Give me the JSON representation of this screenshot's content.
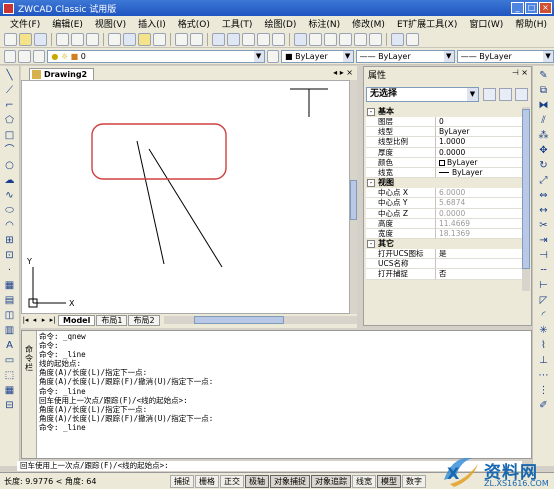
{
  "window": {
    "title": "ZWCAD Classic 试用版"
  },
  "menu": [
    "文件(F)",
    "编辑(E)",
    "视图(V)",
    "插入(I)",
    "格式(O)",
    "工具(T)",
    "绘图(D)",
    "标注(N)",
    "修改(M)",
    "ET扩展工具(X)",
    "窗口(W)",
    "帮助(H)"
  ],
  "toolbar": {
    "layer_value": "0",
    "color_value": "ByLayer",
    "linetype_value": "ByLayer",
    "lineweight_value": "ByLayer"
  },
  "document": {
    "tab_label": "Drawing2",
    "layout_tabs": [
      "Model",
      "布局1",
      "布局2"
    ],
    "ucs_x_label": "X",
    "ucs_y_label": "Y"
  },
  "properties": {
    "title": "属性",
    "selection": "无选择",
    "categories": [
      {
        "name": "基本",
        "rows": [
          {
            "key": "图层",
            "value": "0"
          },
          {
            "key": "线型",
            "value": "ByLayer"
          },
          {
            "key": "线型比例",
            "value": "1.0000"
          },
          {
            "key": "厚度",
            "value": "0.0000"
          },
          {
            "key": "颜色",
            "value": "ByLayer"
          },
          {
            "key": "线宽",
            "value": "ByLayer"
          }
        ]
      },
      {
        "name": "视图",
        "rows": [
          {
            "key": "中心点 X",
            "value": "6.0000"
          },
          {
            "key": "中心点 Y",
            "value": "5.6874"
          },
          {
            "key": "中心点 Z",
            "value": "0.0000"
          },
          {
            "key": "高度",
            "value": "11.4669"
          },
          {
            "key": "宽度",
            "value": "18.1369"
          }
        ]
      },
      {
        "name": "其它",
        "rows": [
          {
            "key": "打开UCS图标",
            "value": "是"
          },
          {
            "key": "UCS名称",
            "value": ""
          },
          {
            "key": "打开捕捉",
            "value": "否"
          }
        ]
      }
    ]
  },
  "command": {
    "side_label": [
      "命",
      "令",
      "栏"
    ],
    "lines": [
      "命令: _qnew",
      "命令:",
      "命令: _line",
      "线的起始点:",
      "角度(A)/长度(L)/指定下一点:",
      "角度(A)/长度(L)/跟踪(F)/撤消(U)/指定下一点:",
      "命令: _line",
      "回车使用上一次点/跟踪(F)/<线的起始点>:",
      "角度(A)/长度(L)/指定下一点:",
      "角度(A)/长度(L)/跟踪(F)/撤消(U)/指定下一点:",
      "命令: _line"
    ],
    "prompt": "回车使用上一次点/跟踪(F)/<线的起始点>:"
  },
  "status": {
    "coords": "长度: 9.9776 < 角度: 64",
    "toggles": [
      "捕捉",
      "栅格",
      "正交",
      "极轴",
      "对象捕捉",
      "对象追踪",
      "线宽",
      "模型",
      "数字"
    ]
  },
  "watermark": {
    "text": "资料网",
    "url": "ZL.XS1616.COM"
  },
  "colors": {
    "title_bar": "#1f55c0",
    "highlight": "#d04040",
    "watermark": "#1868b0"
  }
}
